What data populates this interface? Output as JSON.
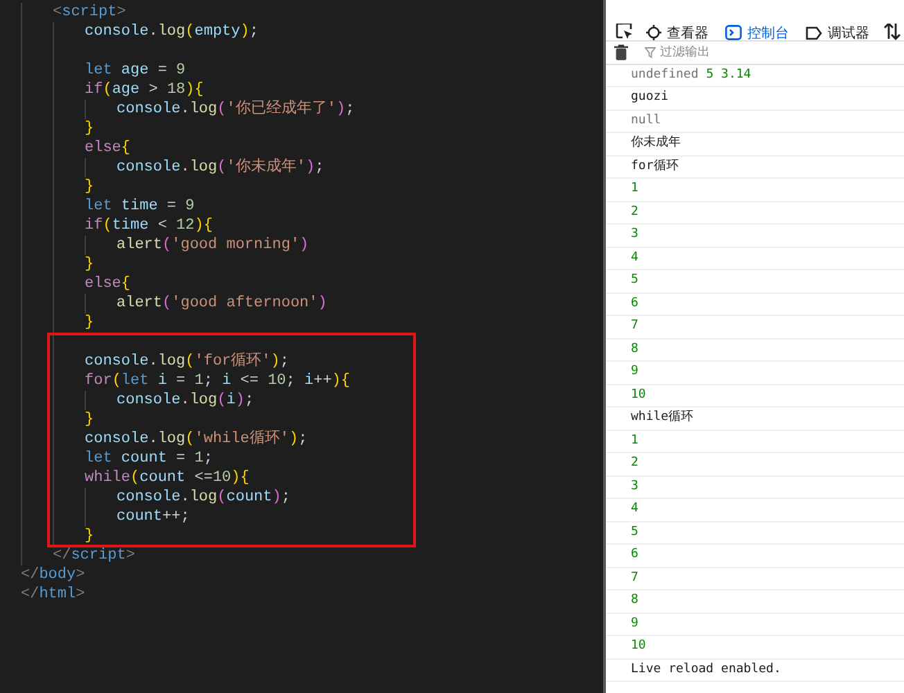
{
  "editor": {
    "lines": [
      {
        "kind": "group",
        "children": [
          {
            "kind": "code",
            "tokens": [
              {
                "kind": "tag",
                "text": "<"
              },
              {
                "kind": "tagname",
                "text": "script"
              },
              {
                "kind": "tag",
                "text": ">"
              }
            ],
            "children": [
              {
                "kind": "code",
                "tokens": [
                  {
                    "kind": "var",
                    "text": "console"
                  },
                  {
                    "kind": "op",
                    "text": "."
                  },
                  {
                    "kind": "fn",
                    "text": "log"
                  },
                  {
                    "kind": "br1",
                    "text": "("
                  },
                  {
                    "kind": "var",
                    "text": "empty"
                  },
                  {
                    "kind": "br1",
                    "text": ")"
                  },
                  {
                    "kind": "op",
                    "text": ";"
                  }
                ]
              },
              {
                "kind": "blank"
              },
              {
                "kind": "code",
                "tokens": [
                  {
                    "kind": "kw",
                    "text": "let"
                  },
                  {
                    "kind": "var",
                    "text": " age"
                  },
                  {
                    "kind": "op",
                    "text": " = "
                  },
                  {
                    "kind": "num",
                    "text": "9"
                  }
                ]
              },
              {
                "kind": "code",
                "tokens": [
                  {
                    "kind": "ctl",
                    "text": "if"
                  },
                  {
                    "kind": "br1",
                    "text": "("
                  },
                  {
                    "kind": "var",
                    "text": "age"
                  },
                  {
                    "kind": "op",
                    "text": " > "
                  },
                  {
                    "kind": "num",
                    "text": "18"
                  },
                  {
                    "kind": "br1",
                    "text": ")"
                  },
                  {
                    "kind": "br1",
                    "text": "{"
                  }
                ],
                "children": [
                  {
                    "kind": "code",
                    "tokens": [
                      {
                        "kind": "var",
                        "text": "console"
                      },
                      {
                        "kind": "op",
                        "text": "."
                      },
                      {
                        "kind": "fn",
                        "text": "log"
                      },
                      {
                        "kind": "br2",
                        "text": "("
                      },
                      {
                        "kind": "str",
                        "text": "'你已经成年了'"
                      },
                      {
                        "kind": "br2",
                        "text": ")"
                      },
                      {
                        "kind": "op",
                        "text": ";"
                      }
                    ]
                  }
                ]
              },
              {
                "kind": "code",
                "tokens": [
                  {
                    "kind": "br1",
                    "text": "}"
                  }
                ]
              },
              {
                "kind": "code",
                "tokens": [
                  {
                    "kind": "ctl",
                    "text": "else"
                  },
                  {
                    "kind": "br1",
                    "text": "{"
                  }
                ],
                "children": [
                  {
                    "kind": "code",
                    "tokens": [
                      {
                        "kind": "var",
                        "text": "console"
                      },
                      {
                        "kind": "op",
                        "text": "."
                      },
                      {
                        "kind": "fn",
                        "text": "log"
                      },
                      {
                        "kind": "br2",
                        "text": "("
                      },
                      {
                        "kind": "str",
                        "text": "'你未成年'"
                      },
                      {
                        "kind": "br2",
                        "text": ")"
                      },
                      {
                        "kind": "op",
                        "text": ";"
                      }
                    ]
                  }
                ]
              },
              {
                "kind": "code",
                "tokens": [
                  {
                    "kind": "br1",
                    "text": "}"
                  }
                ]
              },
              {
                "kind": "code",
                "tokens": [
                  {
                    "kind": "kw",
                    "text": "let"
                  },
                  {
                    "kind": "var",
                    "text": " time"
                  },
                  {
                    "kind": "op",
                    "text": " = "
                  },
                  {
                    "kind": "num",
                    "text": "9"
                  }
                ]
              },
              {
                "kind": "code",
                "tokens": [
                  {
                    "kind": "ctl",
                    "text": "if"
                  },
                  {
                    "kind": "br1",
                    "text": "("
                  },
                  {
                    "kind": "var",
                    "text": "time"
                  },
                  {
                    "kind": "op",
                    "text": " < "
                  },
                  {
                    "kind": "num",
                    "text": "12"
                  },
                  {
                    "kind": "br1",
                    "text": ")"
                  },
                  {
                    "kind": "br1",
                    "text": "{"
                  }
                ],
                "children": [
                  {
                    "kind": "code",
                    "tokens": [
                      {
                        "kind": "fn",
                        "text": "alert"
                      },
                      {
                        "kind": "br2",
                        "text": "("
                      },
                      {
                        "kind": "str",
                        "text": "'good morning'"
                      },
                      {
                        "kind": "br2",
                        "text": ")"
                      }
                    ]
                  }
                ]
              },
              {
                "kind": "code",
                "tokens": [
                  {
                    "kind": "br1",
                    "text": "}"
                  }
                ]
              },
              {
                "kind": "code",
                "tokens": [
                  {
                    "kind": "ctl",
                    "text": "else"
                  },
                  {
                    "kind": "br1",
                    "text": "{"
                  }
                ],
                "children": [
                  {
                    "kind": "code",
                    "tokens": [
                      {
                        "kind": "fn",
                        "text": "alert"
                      },
                      {
                        "kind": "br2",
                        "text": "("
                      },
                      {
                        "kind": "str",
                        "text": "'good afternoon'"
                      },
                      {
                        "kind": "br2",
                        "text": ")"
                      }
                    ]
                  }
                ]
              },
              {
                "kind": "code",
                "tokens": [
                  {
                    "kind": "br1",
                    "text": "}"
                  }
                ]
              },
              {
                "kind": "highlight",
                "children": [
                  {
                    "kind": "blank"
                  },
                  {
                    "kind": "code",
                    "tokens": [
                      {
                        "kind": "var",
                        "text": "console"
                      },
                      {
                        "kind": "op",
                        "text": "."
                      },
                      {
                        "kind": "fn",
                        "text": "log"
                      },
                      {
                        "kind": "br1",
                        "text": "("
                      },
                      {
                        "kind": "str",
                        "text": "'for循环'"
                      },
                      {
                        "kind": "br1",
                        "text": ")"
                      },
                      {
                        "kind": "op",
                        "text": ";"
                      }
                    ]
                  },
                  {
                    "kind": "code",
                    "tokens": [
                      {
                        "kind": "ctl",
                        "text": "for"
                      },
                      {
                        "kind": "br1",
                        "text": "("
                      },
                      {
                        "kind": "kw",
                        "text": "let"
                      },
                      {
                        "kind": "var",
                        "text": " i"
                      },
                      {
                        "kind": "op",
                        "text": " = "
                      },
                      {
                        "kind": "num",
                        "text": "1"
                      },
                      {
                        "kind": "op",
                        "text": "; "
                      },
                      {
                        "kind": "var",
                        "text": "i"
                      },
                      {
                        "kind": "op",
                        "text": " <= "
                      },
                      {
                        "kind": "num",
                        "text": "10"
                      },
                      {
                        "kind": "op",
                        "text": "; "
                      },
                      {
                        "kind": "var",
                        "text": "i"
                      },
                      {
                        "kind": "op",
                        "text": "++"
                      },
                      {
                        "kind": "br1",
                        "text": ")"
                      },
                      {
                        "kind": "br1",
                        "text": "{"
                      }
                    ],
                    "children": [
                      {
                        "kind": "code",
                        "tokens": [
                          {
                            "kind": "var",
                            "text": "console"
                          },
                          {
                            "kind": "op",
                            "text": "."
                          },
                          {
                            "kind": "fn",
                            "text": "log"
                          },
                          {
                            "kind": "br2",
                            "text": "("
                          },
                          {
                            "kind": "var",
                            "text": "i"
                          },
                          {
                            "kind": "br2",
                            "text": ")"
                          },
                          {
                            "kind": "op",
                            "text": ";"
                          }
                        ]
                      }
                    ]
                  },
                  {
                    "kind": "code",
                    "tokens": [
                      {
                        "kind": "br1",
                        "text": "}"
                      }
                    ]
                  },
                  {
                    "kind": "code",
                    "tokens": [
                      {
                        "kind": "var",
                        "text": "console"
                      },
                      {
                        "kind": "op",
                        "text": "."
                      },
                      {
                        "kind": "fn",
                        "text": "log"
                      },
                      {
                        "kind": "br1",
                        "text": "("
                      },
                      {
                        "kind": "str",
                        "text": "'while循环'"
                      },
                      {
                        "kind": "br1",
                        "text": ")"
                      },
                      {
                        "kind": "op",
                        "text": ";"
                      }
                    ]
                  },
                  {
                    "kind": "code",
                    "tokens": [
                      {
                        "kind": "kw",
                        "text": "let"
                      },
                      {
                        "kind": "var",
                        "text": " count"
                      },
                      {
                        "kind": "op",
                        "text": " = "
                      },
                      {
                        "kind": "num",
                        "text": "1"
                      },
                      {
                        "kind": "op",
                        "text": ";"
                      }
                    ]
                  },
                  {
                    "kind": "code",
                    "tokens": [
                      {
                        "kind": "ctl",
                        "text": "while"
                      },
                      {
                        "kind": "br1",
                        "text": "("
                      },
                      {
                        "kind": "var",
                        "text": "count"
                      },
                      {
                        "kind": "op",
                        "text": " <="
                      },
                      {
                        "kind": "num",
                        "text": "10"
                      },
                      {
                        "kind": "br1",
                        "text": ")"
                      },
                      {
                        "kind": "br1",
                        "text": "{"
                      }
                    ],
                    "children": [
                      {
                        "kind": "code",
                        "tokens": [
                          {
                            "kind": "var",
                            "text": "console"
                          },
                          {
                            "kind": "op",
                            "text": "."
                          },
                          {
                            "kind": "fn",
                            "text": "log"
                          },
                          {
                            "kind": "br2",
                            "text": "("
                          },
                          {
                            "kind": "var",
                            "text": "count"
                          },
                          {
                            "kind": "br2",
                            "text": ")"
                          },
                          {
                            "kind": "op",
                            "text": ";"
                          }
                        ]
                      },
                      {
                        "kind": "code",
                        "tokens": [
                          {
                            "kind": "var",
                            "text": "count"
                          },
                          {
                            "kind": "op",
                            "text": "++;"
                          }
                        ]
                      }
                    ]
                  },
                  {
                    "kind": "code",
                    "tokens": [
                      {
                        "kind": "br1",
                        "text": "}"
                      }
                    ]
                  }
                ]
              }
            ]
          },
          {
            "kind": "code",
            "tokens": [
              {
                "kind": "tag",
                "text": "</"
              },
              {
                "kind": "tagname",
                "text": "script"
              },
              {
                "kind": "tag",
                "text": ">"
              }
            ]
          }
        ]
      },
      {
        "kind": "code",
        "tokens": [
          {
            "kind": "tag",
            "text": "</"
          },
          {
            "kind": "tagname",
            "text": "body"
          },
          {
            "kind": "tag",
            "text": ">"
          }
        ]
      },
      {
        "kind": "code",
        "tokens": [
          {
            "kind": "tag",
            "text": "</"
          },
          {
            "kind": "tagname",
            "text": "html"
          },
          {
            "kind": "tag",
            "text": ">"
          }
        ]
      }
    ]
  },
  "devtools": {
    "tabs": [
      {
        "label": "查看器",
        "selected": false
      },
      {
        "label": "控制台",
        "selected": true
      },
      {
        "label": "调试器",
        "selected": false
      }
    ],
    "filter": {
      "placeholder": "过滤输出"
    },
    "console_rows": [
      {
        "parts": [
          {
            "kind": "undefined",
            "text": "undefined"
          },
          {
            "kind": "number",
            "text": "5"
          },
          {
            "kind": "number",
            "text": "3.14"
          }
        ]
      },
      {
        "parts": [
          {
            "kind": "string",
            "text": "guozi"
          }
        ]
      },
      {
        "parts": [
          {
            "kind": "undefined",
            "text": "null"
          }
        ]
      },
      {
        "parts": [
          {
            "kind": "string",
            "text": "你未成年"
          }
        ]
      },
      {
        "parts": [
          {
            "kind": "string",
            "text": "for循环"
          }
        ]
      },
      {
        "parts": [
          {
            "kind": "number",
            "text": "1"
          }
        ]
      },
      {
        "parts": [
          {
            "kind": "number",
            "text": "2"
          }
        ]
      },
      {
        "parts": [
          {
            "kind": "number",
            "text": "3"
          }
        ]
      },
      {
        "parts": [
          {
            "kind": "number",
            "text": "4"
          }
        ]
      },
      {
        "parts": [
          {
            "kind": "number",
            "text": "5"
          }
        ]
      },
      {
        "parts": [
          {
            "kind": "number",
            "text": "6"
          }
        ]
      },
      {
        "parts": [
          {
            "kind": "number",
            "text": "7"
          }
        ]
      },
      {
        "parts": [
          {
            "kind": "number",
            "text": "8"
          }
        ]
      },
      {
        "parts": [
          {
            "kind": "number",
            "text": "9"
          }
        ]
      },
      {
        "parts": [
          {
            "kind": "number",
            "text": "10"
          }
        ]
      },
      {
        "parts": [
          {
            "kind": "string",
            "text": "while循环"
          }
        ]
      },
      {
        "parts": [
          {
            "kind": "number",
            "text": "1"
          }
        ]
      },
      {
        "parts": [
          {
            "kind": "number",
            "text": "2"
          }
        ]
      },
      {
        "parts": [
          {
            "kind": "number",
            "text": "3"
          }
        ]
      },
      {
        "parts": [
          {
            "kind": "number",
            "text": "4"
          }
        ]
      },
      {
        "parts": [
          {
            "kind": "number",
            "text": "5"
          }
        ]
      },
      {
        "parts": [
          {
            "kind": "number",
            "text": "6"
          }
        ]
      },
      {
        "parts": [
          {
            "kind": "number",
            "text": "7"
          }
        ]
      },
      {
        "parts": [
          {
            "kind": "number",
            "text": "8"
          }
        ]
      },
      {
        "parts": [
          {
            "kind": "number",
            "text": "9"
          }
        ]
      },
      {
        "parts": [
          {
            "kind": "number",
            "text": "10"
          }
        ]
      },
      {
        "parts": [
          {
            "kind": "string",
            "text": "Live reload enabled."
          }
        ]
      }
    ]
  }
}
